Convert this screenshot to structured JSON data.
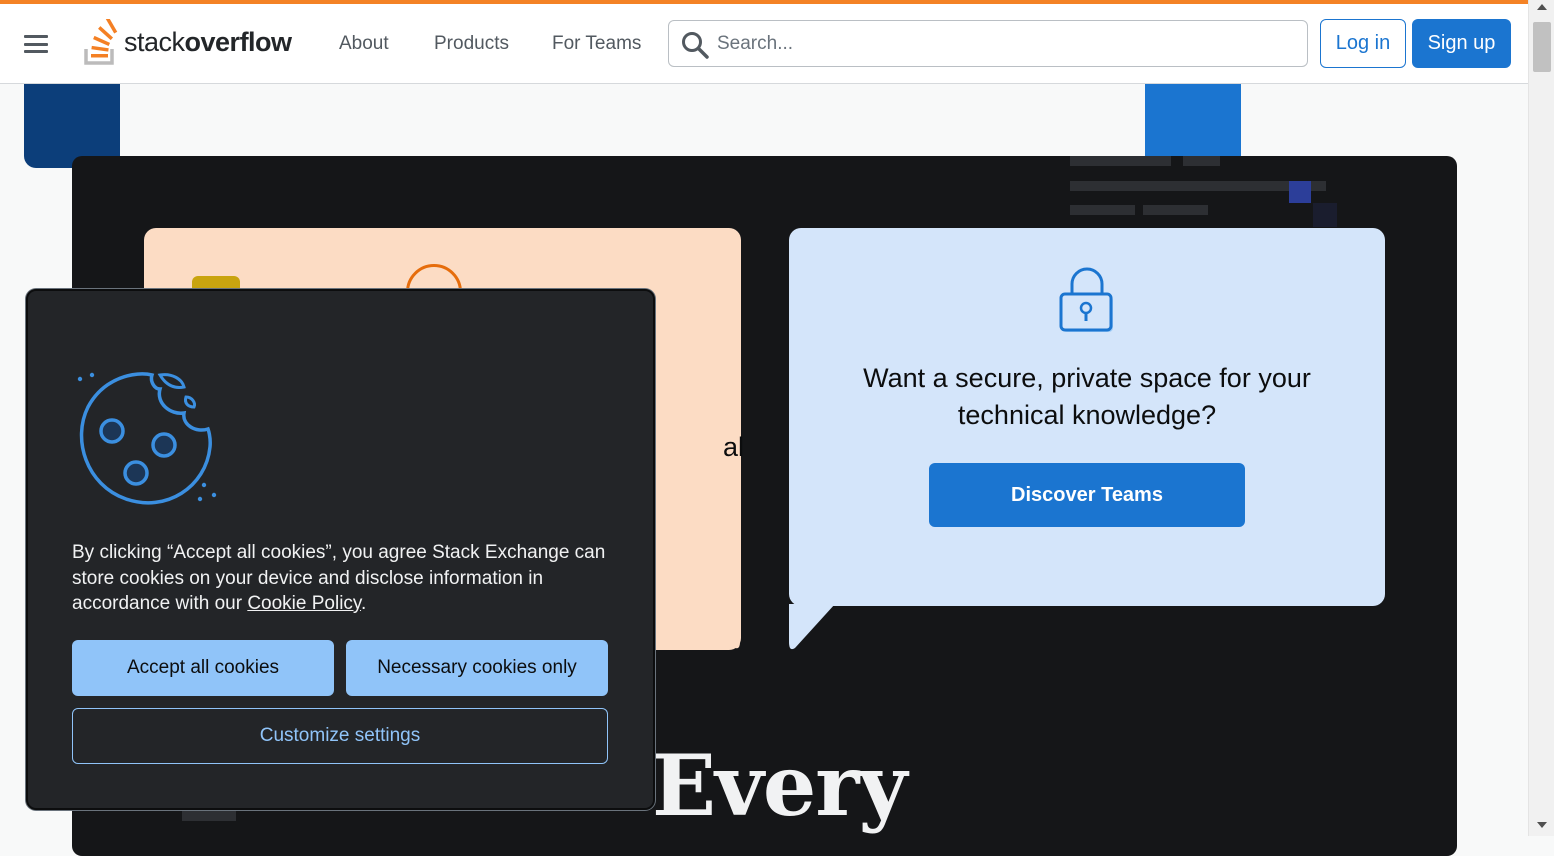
{
  "header": {
    "logo": {
      "light": "stack",
      "bold": "overflow"
    },
    "nav": [
      "About",
      "Products",
      "For Teams"
    ],
    "search": {
      "placeholder": "Search...",
      "value": ""
    },
    "login_label": "Log in",
    "signup_label": "Sign up"
  },
  "hero": {
    "orange_card_partial_text": "al",
    "teams_card": {
      "text": "Want a secure, private space for your technical knowledge?",
      "button_label": "Discover Teams"
    },
    "headline_partial": "Every"
  },
  "cookie_banner": {
    "text_before_link": "By clicking “Accept all cookies”, you agree Stack Exchange can store cookies on your device and disclose information in accordance with our ",
    "link_label": "Cookie Policy",
    "text_after_link": ".",
    "accept_label": "Accept all cookies",
    "necessary_label": "Necessary cookies only",
    "customize_label": "Customize settings"
  },
  "colors": {
    "accent_orange": "#f48225",
    "primary_blue": "#1b75d0",
    "cookie_button": "#90c4f9",
    "hero_bg": "#151618"
  }
}
